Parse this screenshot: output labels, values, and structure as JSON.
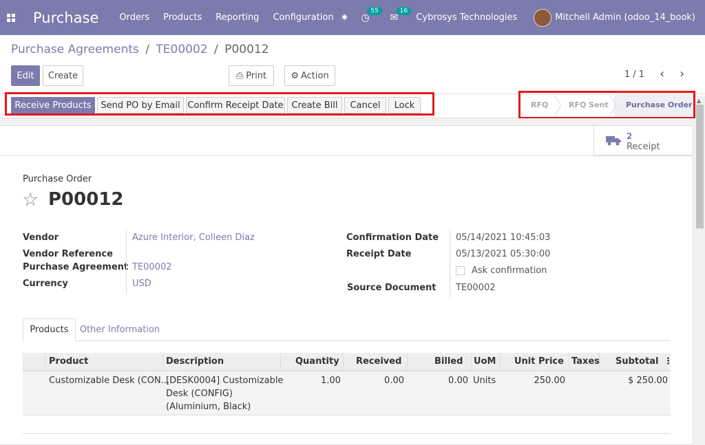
{
  "navbar": {
    "app_name": "Purchase",
    "menu": [
      "Orders",
      "Products",
      "Reporting",
      "Configuration"
    ],
    "activity_count": "55",
    "message_count": "16",
    "company": "Cybrosys Technologies",
    "user": "Mitchell Admin (odoo_14_book)"
  },
  "breadcrumb": {
    "level1": "Purchase Agreements",
    "level2": "TE00002",
    "current": "P00012",
    "separator": "/"
  },
  "control_panel": {
    "edit_label": "Edit",
    "create_label": "Create",
    "print_label": "Print",
    "action_label": "Action",
    "pager": "1 / 1"
  },
  "statusbar": {
    "buttons": [
      "Receive Products",
      "Send PO by Email",
      "Confirm Receipt Date",
      "Create Bill",
      "Cancel",
      "Lock"
    ],
    "stages": [
      "RFQ",
      "RFQ Sent",
      "Purchase Order"
    ],
    "active_stage": "Purchase Order"
  },
  "smart_button": {
    "value": "2",
    "label": "Receipt"
  },
  "form": {
    "doc_type": "Purchase Order",
    "doc_name": "P00012",
    "vendor_label": "Vendor",
    "vendor": "Azure Interior, Colleen Diaz",
    "vendor_ref_label": "Vendor Reference",
    "agreement_label": "Purchase Agreement",
    "agreement": "TE00002",
    "currency_label": "Currency",
    "currency": "USD",
    "confirmation_date_label": "Confirmation Date",
    "confirmation_date": "05/14/2021 10:45:03",
    "receipt_date_label": "Receipt Date",
    "receipt_date": "05/13/2021 05:30:00",
    "ask_confirmation_label": "Ask confirmation",
    "source_doc_label": "Source Document",
    "source_doc": "TE00002"
  },
  "tabs": [
    "Products",
    "Other Information"
  ],
  "table": {
    "headers": [
      "Product",
      "Description",
      "Quantity",
      "Received",
      "Billed",
      "UoM",
      "Unit Price",
      "Taxes",
      "Subtotal"
    ],
    "rows": [
      {
        "product": "Customizable Desk (CON...",
        "description_line1": "[DESK0004] Customizable",
        "description_line2": "Desk (CONFIG)",
        "description_line3": "(Aluminium, Black)",
        "quantity": "1.00",
        "received": "0.00",
        "billed": "0.00",
        "uom": "Units",
        "unit_price": "250.00",
        "taxes": "",
        "subtotal": "$ 250.00"
      }
    ]
  },
  "colors": {
    "brand": "#7c7bad",
    "highlight_box": "#e0191d"
  }
}
